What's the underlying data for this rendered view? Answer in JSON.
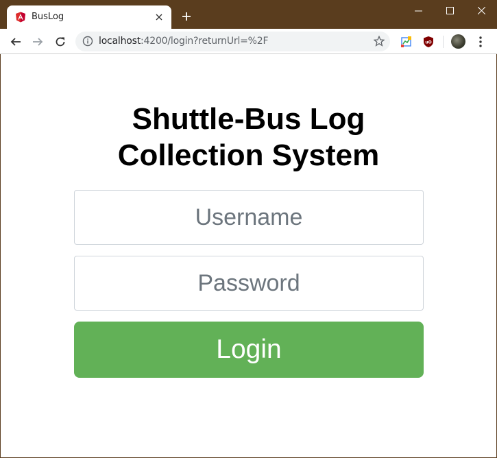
{
  "browser": {
    "tab": {
      "title": "BusLog",
      "favicon": "angular-icon"
    },
    "address_bar": {
      "host": "localhost",
      "path": ":4200/login?returnUrl=%2F"
    },
    "colors": {
      "frame": "#5a3d1e",
      "omnibox": "#f1f3f4"
    }
  },
  "page": {
    "title_line1": "Shuttle-Bus Log",
    "title_line2": "Collection System",
    "username": {
      "placeholder": "Username",
      "value": ""
    },
    "password": {
      "placeholder": "Password",
      "value": ""
    },
    "login_label": "Login",
    "colors": {
      "login_button": "#62b157",
      "placeholder": "#6c757d"
    }
  }
}
